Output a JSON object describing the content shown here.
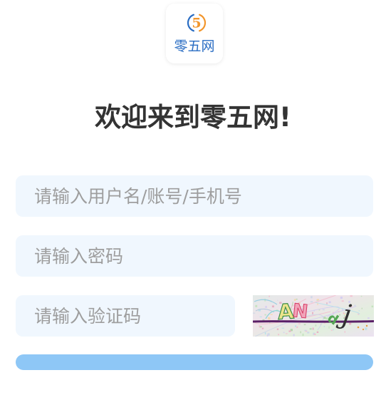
{
  "logo": {
    "digit": "5",
    "text": "零五网"
  },
  "heading": "欢迎来到零五网!",
  "form": {
    "username_placeholder": "请输入用户名/账号/手机号",
    "password_placeholder": "请输入密码",
    "captcha_placeholder": "请输入验证码"
  },
  "captcha": {
    "chars": [
      "A",
      "N",
      "d",
      "j"
    ]
  },
  "colors": {
    "heading": "#333333",
    "input_bg": "#f0f7fe",
    "placeholder": "#9e9e9e",
    "button": "#8ec7f6",
    "logo_blue": "#2a6dc3",
    "logo_orange": "#f2962c"
  }
}
